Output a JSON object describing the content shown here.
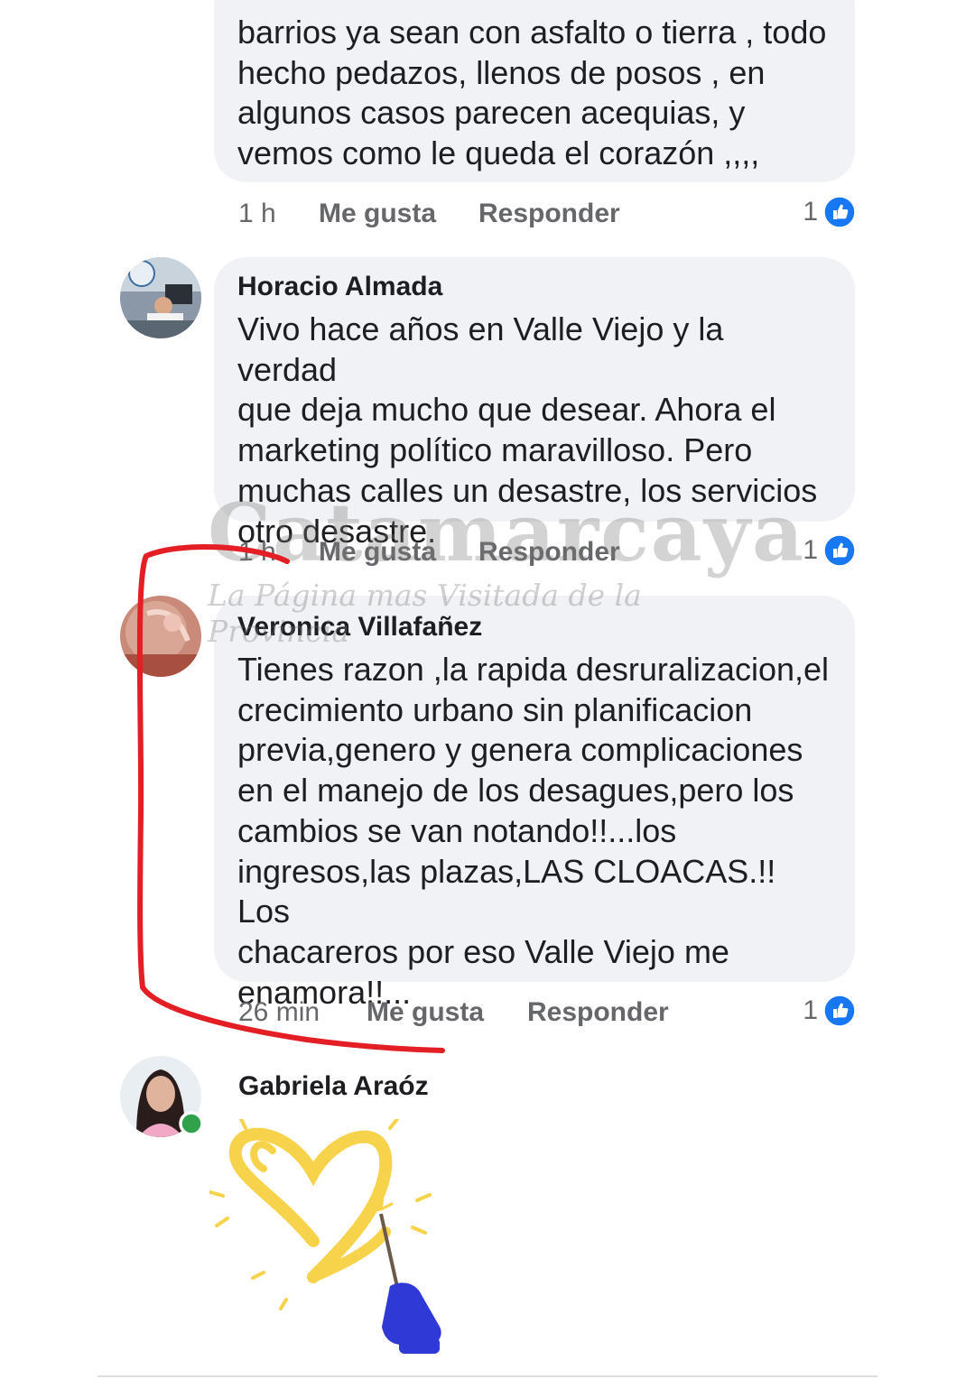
{
  "colors": {
    "bubble": "#f0f2f5",
    "meta_text": "#65676b",
    "like_blue": "#1877f2",
    "annotation_red": "#e31e24",
    "online_green": "#31a24c"
  },
  "comments": [
    {
      "author": "",
      "text": "barrios ya sean con asfalto o tierra , todo\nhecho pedazos, llenos de posos , en\nalgunos casos parecen acequias, y\nvemos como le queda el corazón ,,,,",
      "time": "1 h",
      "like_label": "Me gusta",
      "reply_label": "Responder",
      "likes": "1"
    },
    {
      "author": "Horacio Almada",
      "avatar_icon": "profile-photo-icon",
      "text": "Vivo hace años en Valle Viejo y la verdad\nque deja mucho que desear. Ahora el\nmarketing político maravilloso. Pero\nmuchas calles un desastre, los servicios\notro desastre.",
      "time": "1 h",
      "like_label": "Me gusta",
      "reply_label": "Responder",
      "likes": "1"
    },
    {
      "author": "Veronica Villafañez",
      "avatar_icon": "profile-photo-icon",
      "text": "Tienes razon ,la rapida desruralizacion,el\ncrecimiento urbano sin planificacion\nprevia,genero y genera complicaciones\nen el manejo de los desagues,pero los\ncambios se van notando!!...los\ningresos,las plazas,LAS CLOACAS.!! Los\nchacareros por eso  Valle Viejo me\nenamora!!...",
      "time": "26 min",
      "like_label": "Me gusta",
      "reply_label": "Responder",
      "likes": "1"
    },
    {
      "author": "Gabriela Araóz",
      "avatar_icon": "profile-photo-icon",
      "online_icon": "online-status-icon",
      "sticker_icon": "heart-sparkler-sticker-icon"
    }
  ],
  "watermark": {
    "title": "Catamarcaya",
    "subtitle": "La Página mas Visitada de la Provincia"
  },
  "icons": {
    "like": "like-thumb-icon",
    "annotation": "red-bracket-annotation"
  }
}
